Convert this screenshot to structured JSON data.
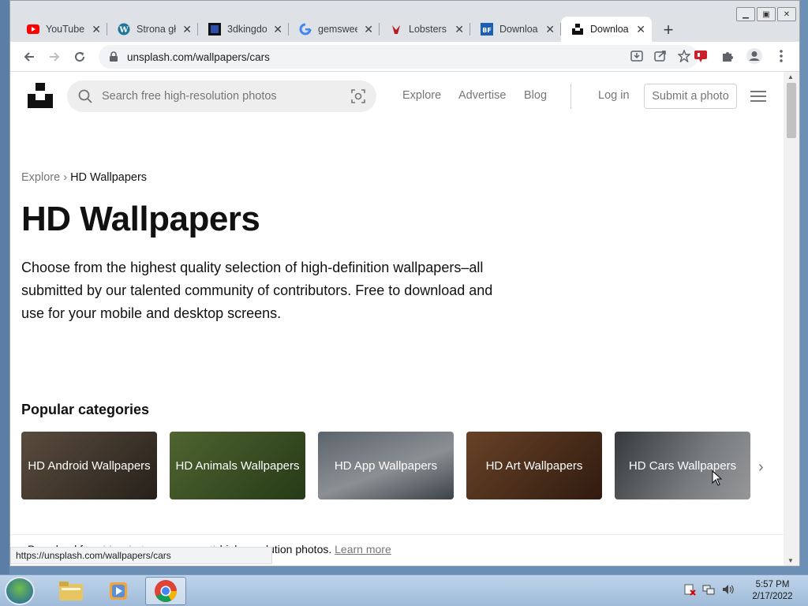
{
  "browser": {
    "tabs": [
      {
        "title": "YouTube",
        "favicon": "youtube-icon"
      },
      {
        "title": "Strona gł",
        "favicon": "wordpress-icon"
      },
      {
        "title": "3dkingdo",
        "favicon": "3dk-icon"
      },
      {
        "title": "gemswee",
        "favicon": "google-icon"
      },
      {
        "title": "Lobsters",
        "favicon": "lobster-icon"
      },
      {
        "title": "Downloa",
        "favicon": "bigfish-icon"
      },
      {
        "title": "Downloa",
        "favicon": "unsplash-icon",
        "active": true
      }
    ],
    "url": "unsplash.com/wallpapers/cars",
    "status_url": "https://unsplash.com/wallpapers/cars"
  },
  "header": {
    "search_placeholder": "Search free high-resolution photos",
    "nav": [
      "Explore",
      "Advertise",
      "Blog"
    ],
    "login": "Log in",
    "submit": "Submit a photo"
  },
  "breadcrumb": {
    "parent": "Explore",
    "sep": "›",
    "current": "HD Wallpapers"
  },
  "title": "HD Wallpapers",
  "description": "Choose from the highest quality selection of high-definition wallpapers–all submitted by our talented community of contributors. Free to download and use for your mobile and desktop screens.",
  "popular_heading": "Popular categories",
  "categories": [
    {
      "label": "HD Android Wallpapers",
      "color": "#6b5a4a"
    },
    {
      "label": "HD Animals Wallpapers",
      "color": "#5d7a3a"
    },
    {
      "label": "HD App Wallpapers",
      "color": "#6d7a85"
    },
    {
      "label": "HD Art Wallpapers",
      "color": "#7a4a2e"
    },
    {
      "label": "HD Cars Wallpapers",
      "color": "#8a8f95"
    }
  ],
  "footer": {
    "pre": "Download free",
    "mid": "(do whatever you want)",
    "post": "high-resolution photos.",
    "link": "Learn more"
  },
  "taskbar": {
    "time": "5:57 PM",
    "date": "2/17/2022"
  }
}
